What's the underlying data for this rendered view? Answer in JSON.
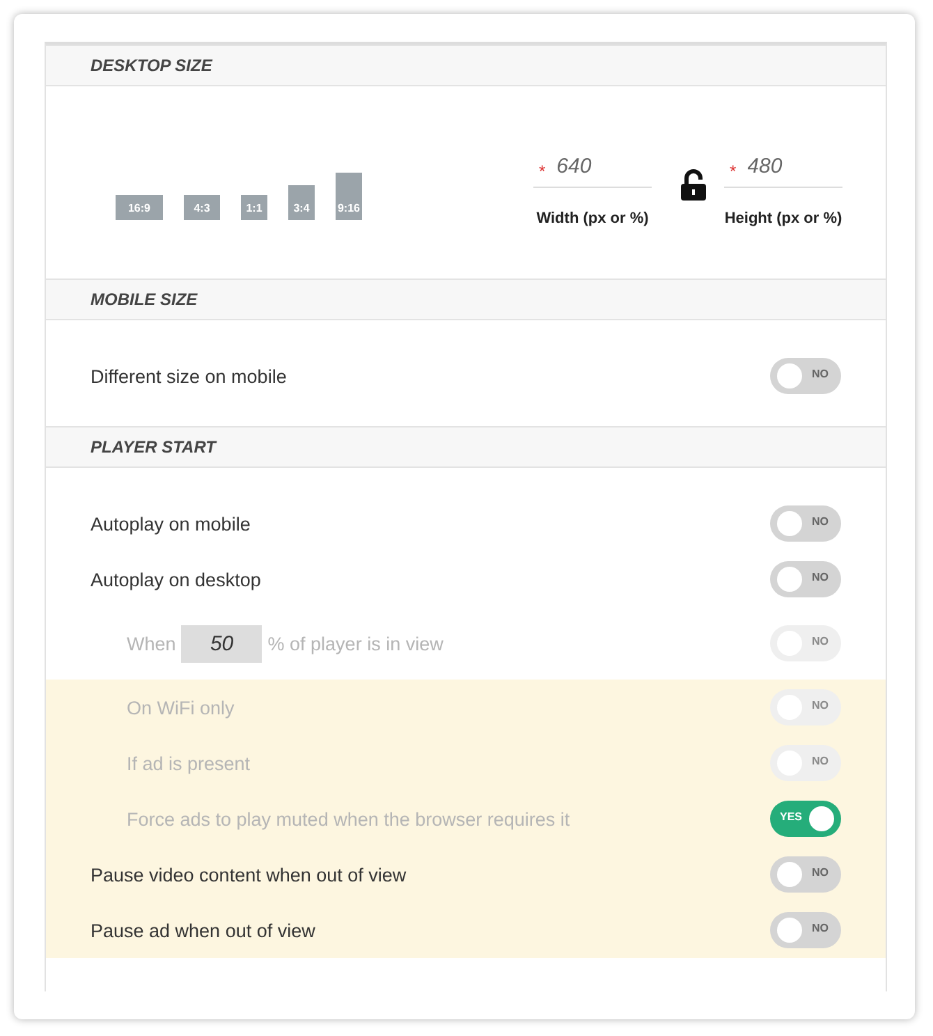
{
  "sections": [
    {
      "title": "DESKTOP SIZE",
      "kind": "desktop",
      "ratios": [
        "16:9",
        "4:3",
        "1:1",
        "3:4",
        "9:16"
      ],
      "fields": [
        {
          "required_mark": "*",
          "value": "640",
          "label": "Width (px or %)"
        },
        {
          "required_mark": "*",
          "value": "480",
          "label": "Height (px or %)"
        }
      ],
      "locked": false
    },
    {
      "title": "MOBILE SIZE",
      "kind": "rows",
      "rows": [
        {
          "kind": "toggle",
          "label": "Different size on mobile",
          "on": false,
          "toggle_text": "NO",
          "disabled": false,
          "indented": false,
          "highlighted": false
        }
      ]
    },
    {
      "title": "PLAYER START",
      "kind": "rows",
      "rows": [
        {
          "kind": "toggle",
          "label": "Autoplay on mobile",
          "on": false,
          "toggle_text": "NO",
          "disabled": false,
          "indented": false,
          "highlighted": false
        },
        {
          "kind": "toggle",
          "label": "Autoplay on desktop",
          "on": false,
          "toggle_text": "NO",
          "disabled": false,
          "indented": false,
          "highlighted": false
        },
        {
          "kind": "percent",
          "prefix": "When",
          "value": "50",
          "suffix": "% of player is in view",
          "on": false,
          "toggle_text": "NO",
          "disabled": true,
          "indented": true,
          "highlighted": false
        },
        {
          "kind": "toggle",
          "label": "On WiFi only",
          "on": false,
          "toggle_text": "NO",
          "disabled": true,
          "indented": true,
          "highlighted": true
        },
        {
          "kind": "toggle",
          "label": "If ad is present",
          "on": false,
          "toggle_text": "NO",
          "disabled": true,
          "indented": true,
          "highlighted": true
        },
        {
          "kind": "toggle",
          "label": "Force ads to play muted when the browser requires it",
          "on": true,
          "toggle_text": "YES",
          "disabled": false,
          "label_disabled": true,
          "indented": true,
          "highlighted": true
        },
        {
          "kind": "toggle",
          "label": "Pause video content when out of view",
          "on": false,
          "toggle_text": "NO",
          "disabled": false,
          "indented": false,
          "highlighted": true
        },
        {
          "kind": "toggle",
          "label": "Pause ad when out of view",
          "on": false,
          "toggle_text": "NO",
          "disabled": false,
          "indented": false,
          "highlighted": true
        }
      ]
    }
  ]
}
